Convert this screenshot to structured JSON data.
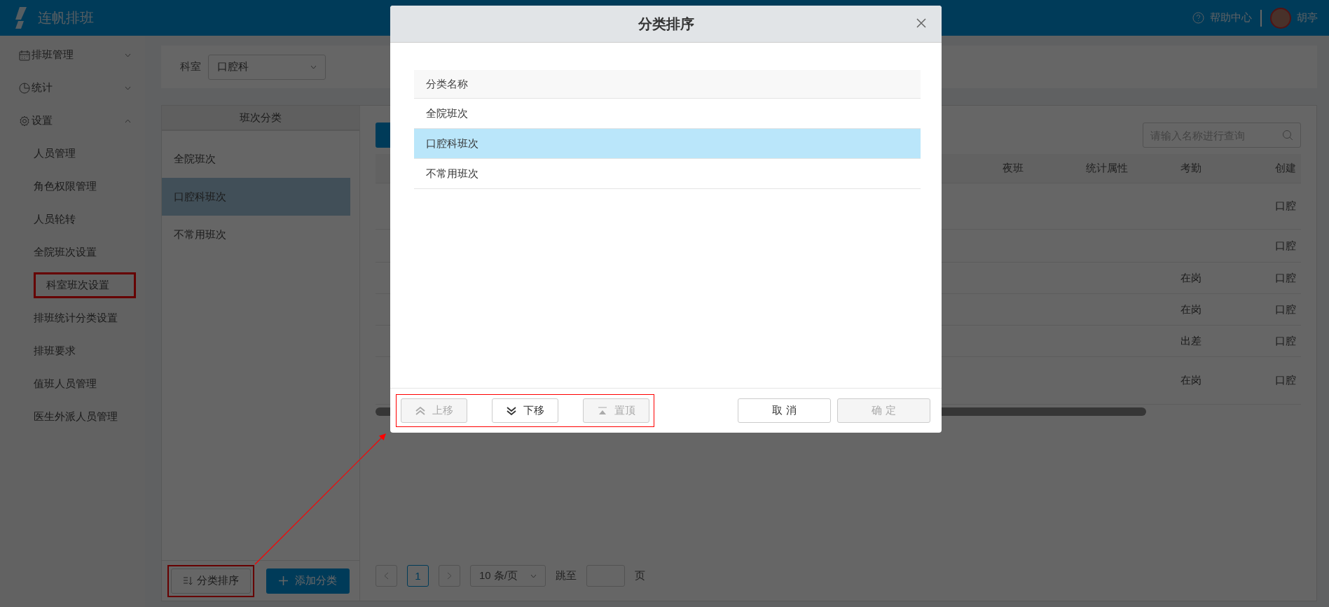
{
  "header": {
    "app_name": "连帆排班",
    "help": "帮助中心",
    "user": "胡亭"
  },
  "sidebar": {
    "items": [
      {
        "label": "排班管理",
        "expanded": false
      },
      {
        "label": "统计",
        "expanded": false
      },
      {
        "label": "设置",
        "expanded": true,
        "children": [
          {
            "label": "人员管理",
            "annotated": false
          },
          {
            "label": "角色权限管理",
            "annotated": false
          },
          {
            "label": "人员轮转",
            "annotated": false
          },
          {
            "label": "全院班次设置",
            "annotated": false
          },
          {
            "label": "科室班次设置",
            "annotated": true
          },
          {
            "label": "排班统计分类设置",
            "annotated": false
          },
          {
            "label": "排班要求",
            "annotated": false
          },
          {
            "label": "值班人员管理",
            "annotated": false
          },
          {
            "label": "医生外派人员管理",
            "annotated": false
          }
        ]
      }
    ]
  },
  "filter": {
    "label": "科室",
    "value": "口腔科"
  },
  "category_panel": {
    "title": "班次分类",
    "items": [
      {
        "label": "全院班次",
        "selected": false
      },
      {
        "label": "口腔科班次",
        "selected": true
      },
      {
        "label": "不常用班次",
        "selected": false
      }
    ],
    "buttons": [
      {
        "kind": "sort",
        "label": "分类排序",
        "annotated": true
      },
      {
        "kind": "add",
        "label": "添加分类",
        "annotated": false
      }
    ]
  },
  "table": {
    "search": {
      "placeholder": "请输入名称进行查询"
    },
    "columns": [
      "夜班",
      "统计属性",
      "考勤",
      "创建"
    ],
    "rows": [
      {
        "attendance": null,
        "creator": "口腔"
      },
      {
        "attendance": null,
        "creator": "口腔"
      },
      {
        "attendance": "在岗",
        "creator": "口腔"
      },
      {
        "attendance": "在岗",
        "creator": "口腔"
      },
      {
        "attendance": "出差",
        "creator": "口腔"
      },
      {
        "attendance": "在岗",
        "creator": "口腔"
      }
    ]
  },
  "pagination": {
    "pages": [
      {
        "label": "1",
        "selected": true
      }
    ],
    "page_size": "10 条/页",
    "jump_label": "跳至",
    "page_unit": "页"
  },
  "dialog": {
    "title": "分类排序",
    "column": "分类名称",
    "rows": [
      {
        "label": "全院班次",
        "selected": false
      },
      {
        "label": "口腔科班次",
        "selected": true
      },
      {
        "label": "不常用班次",
        "selected": false
      }
    ],
    "move_buttons_annotated": true,
    "move_buttons": [
      {
        "kind": "up",
        "label": "上移",
        "disabled": true
      },
      {
        "kind": "down",
        "label": "下移",
        "disabled": false
      },
      {
        "kind": "top",
        "label": "置顶",
        "disabled": true
      }
    ],
    "actions": [
      {
        "label": "取 消",
        "disabled": false
      },
      {
        "label": "确 定",
        "disabled": true
      }
    ]
  }
}
